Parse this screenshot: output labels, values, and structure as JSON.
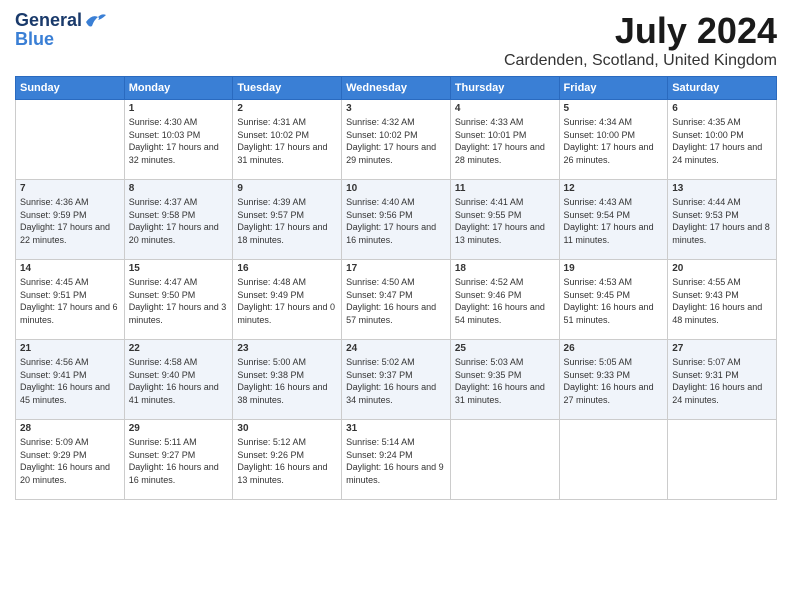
{
  "logo": {
    "general": "General",
    "blue": "Blue"
  },
  "header": {
    "title": "July 2024",
    "subtitle": "Cardenden, Scotland, United Kingdom"
  },
  "columns": [
    "Sunday",
    "Monday",
    "Tuesday",
    "Wednesday",
    "Thursday",
    "Friday",
    "Saturday"
  ],
  "weeks": [
    [
      {
        "day": "",
        "sunrise": "",
        "sunset": "",
        "daylight": ""
      },
      {
        "day": "1",
        "sunrise": "Sunrise: 4:30 AM",
        "sunset": "Sunset: 10:03 PM",
        "daylight": "Daylight: 17 hours and 32 minutes."
      },
      {
        "day": "2",
        "sunrise": "Sunrise: 4:31 AM",
        "sunset": "Sunset: 10:02 PM",
        "daylight": "Daylight: 17 hours and 31 minutes."
      },
      {
        "day": "3",
        "sunrise": "Sunrise: 4:32 AM",
        "sunset": "Sunset: 10:02 PM",
        "daylight": "Daylight: 17 hours and 29 minutes."
      },
      {
        "day": "4",
        "sunrise": "Sunrise: 4:33 AM",
        "sunset": "Sunset: 10:01 PM",
        "daylight": "Daylight: 17 hours and 28 minutes."
      },
      {
        "day": "5",
        "sunrise": "Sunrise: 4:34 AM",
        "sunset": "Sunset: 10:00 PM",
        "daylight": "Daylight: 17 hours and 26 minutes."
      },
      {
        "day": "6",
        "sunrise": "Sunrise: 4:35 AM",
        "sunset": "Sunset: 10:00 PM",
        "daylight": "Daylight: 17 hours and 24 minutes."
      }
    ],
    [
      {
        "day": "7",
        "sunrise": "Sunrise: 4:36 AM",
        "sunset": "Sunset: 9:59 PM",
        "daylight": "Daylight: 17 hours and 22 minutes."
      },
      {
        "day": "8",
        "sunrise": "Sunrise: 4:37 AM",
        "sunset": "Sunset: 9:58 PM",
        "daylight": "Daylight: 17 hours and 20 minutes."
      },
      {
        "day": "9",
        "sunrise": "Sunrise: 4:39 AM",
        "sunset": "Sunset: 9:57 PM",
        "daylight": "Daylight: 17 hours and 18 minutes."
      },
      {
        "day": "10",
        "sunrise": "Sunrise: 4:40 AM",
        "sunset": "Sunset: 9:56 PM",
        "daylight": "Daylight: 17 hours and 16 minutes."
      },
      {
        "day": "11",
        "sunrise": "Sunrise: 4:41 AM",
        "sunset": "Sunset: 9:55 PM",
        "daylight": "Daylight: 17 hours and 13 minutes."
      },
      {
        "day": "12",
        "sunrise": "Sunrise: 4:43 AM",
        "sunset": "Sunset: 9:54 PM",
        "daylight": "Daylight: 17 hours and 11 minutes."
      },
      {
        "day": "13",
        "sunrise": "Sunrise: 4:44 AM",
        "sunset": "Sunset: 9:53 PM",
        "daylight": "Daylight: 17 hours and 8 minutes."
      }
    ],
    [
      {
        "day": "14",
        "sunrise": "Sunrise: 4:45 AM",
        "sunset": "Sunset: 9:51 PM",
        "daylight": "Daylight: 17 hours and 6 minutes."
      },
      {
        "day": "15",
        "sunrise": "Sunrise: 4:47 AM",
        "sunset": "Sunset: 9:50 PM",
        "daylight": "Daylight: 17 hours and 3 minutes."
      },
      {
        "day": "16",
        "sunrise": "Sunrise: 4:48 AM",
        "sunset": "Sunset: 9:49 PM",
        "daylight": "Daylight: 17 hours and 0 minutes."
      },
      {
        "day": "17",
        "sunrise": "Sunrise: 4:50 AM",
        "sunset": "Sunset: 9:47 PM",
        "daylight": "Daylight: 16 hours and 57 minutes."
      },
      {
        "day": "18",
        "sunrise": "Sunrise: 4:52 AM",
        "sunset": "Sunset: 9:46 PM",
        "daylight": "Daylight: 16 hours and 54 minutes."
      },
      {
        "day": "19",
        "sunrise": "Sunrise: 4:53 AM",
        "sunset": "Sunset: 9:45 PM",
        "daylight": "Daylight: 16 hours and 51 minutes."
      },
      {
        "day": "20",
        "sunrise": "Sunrise: 4:55 AM",
        "sunset": "Sunset: 9:43 PM",
        "daylight": "Daylight: 16 hours and 48 minutes."
      }
    ],
    [
      {
        "day": "21",
        "sunrise": "Sunrise: 4:56 AM",
        "sunset": "Sunset: 9:41 PM",
        "daylight": "Daylight: 16 hours and 45 minutes."
      },
      {
        "day": "22",
        "sunrise": "Sunrise: 4:58 AM",
        "sunset": "Sunset: 9:40 PM",
        "daylight": "Daylight: 16 hours and 41 minutes."
      },
      {
        "day": "23",
        "sunrise": "Sunrise: 5:00 AM",
        "sunset": "Sunset: 9:38 PM",
        "daylight": "Daylight: 16 hours and 38 minutes."
      },
      {
        "day": "24",
        "sunrise": "Sunrise: 5:02 AM",
        "sunset": "Sunset: 9:37 PM",
        "daylight": "Daylight: 16 hours and 34 minutes."
      },
      {
        "day": "25",
        "sunrise": "Sunrise: 5:03 AM",
        "sunset": "Sunset: 9:35 PM",
        "daylight": "Daylight: 16 hours and 31 minutes."
      },
      {
        "day": "26",
        "sunrise": "Sunrise: 5:05 AM",
        "sunset": "Sunset: 9:33 PM",
        "daylight": "Daylight: 16 hours and 27 minutes."
      },
      {
        "day": "27",
        "sunrise": "Sunrise: 5:07 AM",
        "sunset": "Sunset: 9:31 PM",
        "daylight": "Daylight: 16 hours and 24 minutes."
      }
    ],
    [
      {
        "day": "28",
        "sunrise": "Sunrise: 5:09 AM",
        "sunset": "Sunset: 9:29 PM",
        "daylight": "Daylight: 16 hours and 20 minutes."
      },
      {
        "day": "29",
        "sunrise": "Sunrise: 5:11 AM",
        "sunset": "Sunset: 9:27 PM",
        "daylight": "Daylight: 16 hours and 16 minutes."
      },
      {
        "day": "30",
        "sunrise": "Sunrise: 5:12 AM",
        "sunset": "Sunset: 9:26 PM",
        "daylight": "Daylight: 16 hours and 13 minutes."
      },
      {
        "day": "31",
        "sunrise": "Sunrise: 5:14 AM",
        "sunset": "Sunset: 9:24 PM",
        "daylight": "Daylight: 16 hours and 9 minutes."
      },
      {
        "day": "",
        "sunrise": "",
        "sunset": "",
        "daylight": ""
      },
      {
        "day": "",
        "sunrise": "",
        "sunset": "",
        "daylight": ""
      },
      {
        "day": "",
        "sunrise": "",
        "sunset": "",
        "daylight": ""
      }
    ]
  ]
}
